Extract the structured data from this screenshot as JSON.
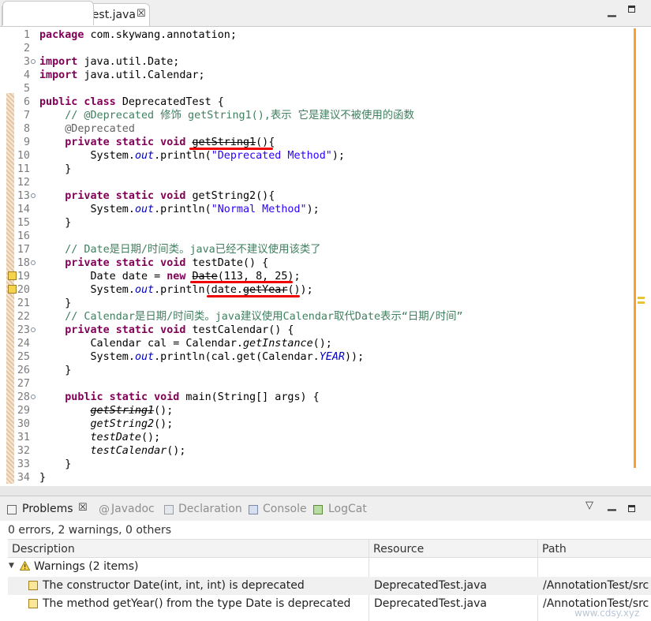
{
  "editor": {
    "tab_label": "DeprecatedTest.java",
    "tab_close": "☒",
    "minimize": "▁",
    "lines": [
      {
        "n": "1",
        "fold": false,
        "warn": false,
        "seg": [
          [
            "kw",
            "package"
          ],
          [
            "",
            "com.skywang.annotation;"
          ]
        ]
      },
      {
        "n": "2",
        "fold": false,
        "warn": false,
        "seg": []
      },
      {
        "n": "3",
        "fold": true,
        "warn": false,
        "seg": [
          [
            "kw",
            "import"
          ],
          [
            "",
            "java.util.Date;"
          ]
        ]
      },
      {
        "n": "4",
        "fold": false,
        "warn": false,
        "seg": [
          [
            "kw",
            "import"
          ],
          [
            "",
            "java.util.Calendar;"
          ]
        ]
      },
      {
        "n": "5",
        "fold": false,
        "warn": false,
        "seg": []
      },
      {
        "n": "6",
        "fold": false,
        "warn": false,
        "seg": [
          [
            "kw",
            "public class"
          ],
          [
            "",
            "DeprecatedTest {"
          ]
        ]
      },
      {
        "n": "7",
        "fold": false,
        "warn": false,
        "seg": [
          [
            "",
            "    "
          ],
          [
            "cm",
            "// @Deprecated 修饰 getString1(),表示 它是建议不被使用的函数"
          ]
        ]
      },
      {
        "n": "8",
        "fold": false,
        "warn": false,
        "seg": [
          [
            "",
            "    "
          ],
          [
            "ann",
            "@Deprecated"
          ]
        ]
      },
      {
        "n": "9",
        "fold": false,
        "warn": false,
        "seg": [
          [
            "",
            "    "
          ],
          [
            "kw",
            "private static void"
          ],
          [
            "",
            " "
          ],
          [
            "dep",
            "getString1"
          ],
          [
            "",
            "(){"
          ]
        ]
      },
      {
        "n": "10",
        "fold": false,
        "warn": false,
        "seg": [
          [
            "",
            "        System."
          ],
          [
            "fld",
            "out"
          ],
          [
            "",
            ".println("
          ],
          [
            "str",
            "\"Deprecated Method\""
          ],
          [
            "",
            ");"
          ]
        ]
      },
      {
        "n": "11",
        "fold": false,
        "warn": false,
        "seg": [
          [
            "",
            "    }"
          ]
        ]
      },
      {
        "n": "12",
        "fold": false,
        "warn": false,
        "seg": []
      },
      {
        "n": "13",
        "fold": true,
        "warn": false,
        "seg": [
          [
            "",
            "    "
          ],
          [
            "kw",
            "private static void"
          ],
          [
            "",
            " getString2(){"
          ]
        ]
      },
      {
        "n": "14",
        "fold": false,
        "warn": false,
        "seg": [
          [
            "",
            "        System."
          ],
          [
            "fld",
            "out"
          ],
          [
            "",
            ".println("
          ],
          [
            "str",
            "\"Normal Method\""
          ],
          [
            "",
            ");"
          ]
        ]
      },
      {
        "n": "15",
        "fold": false,
        "warn": false,
        "seg": [
          [
            "",
            "    }"
          ]
        ]
      },
      {
        "n": "16",
        "fold": false,
        "warn": false,
        "seg": []
      },
      {
        "n": "17",
        "fold": false,
        "warn": false,
        "seg": [
          [
            "",
            "    "
          ],
          [
            "cm",
            "// Date是日期/时间类。java已经不建议使用该类了"
          ]
        ]
      },
      {
        "n": "18",
        "fold": true,
        "warn": false,
        "seg": [
          [
            "",
            "    "
          ],
          [
            "kw",
            "private static void"
          ],
          [
            "",
            " testDate() {"
          ]
        ]
      },
      {
        "n": "19",
        "fold": false,
        "warn": true,
        "seg": [
          [
            "",
            "        Date date = "
          ],
          [
            "kw",
            "new"
          ],
          [
            "",
            " "
          ],
          [
            "dep",
            "Date"
          ],
          [
            "",
            "(113, 8, 25);"
          ]
        ]
      },
      {
        "n": "20",
        "fold": false,
        "warn": true,
        "seg": [
          [
            "",
            "        System."
          ],
          [
            "fld",
            "out"
          ],
          [
            "",
            ".println(date."
          ],
          [
            "dep",
            "getYear"
          ],
          [
            "",
            "());"
          ]
        ]
      },
      {
        "n": "21",
        "fold": false,
        "warn": false,
        "seg": [
          [
            "",
            "    }"
          ]
        ]
      },
      {
        "n": "22",
        "fold": false,
        "warn": false,
        "seg": [
          [
            "",
            "    "
          ],
          [
            "cm",
            "// Calendar是日期/时间类。java建议使用Calendar取代Date表示“日期/时间”"
          ]
        ]
      },
      {
        "n": "23",
        "fold": true,
        "warn": false,
        "seg": [
          [
            "",
            "    "
          ],
          [
            "kw",
            "private static void"
          ],
          [
            "",
            " testCalendar() {"
          ]
        ]
      },
      {
        "n": "24",
        "fold": false,
        "warn": false,
        "seg": [
          [
            "",
            "        Calendar cal = Calendar."
          ],
          [
            "it",
            "getInstance"
          ],
          [
            "",
            "();"
          ]
        ]
      },
      {
        "n": "25",
        "fold": false,
        "warn": false,
        "seg": [
          [
            "",
            "        System."
          ],
          [
            "fld",
            "out"
          ],
          [
            "",
            ".println(cal.get(Calendar."
          ],
          [
            "fld",
            "YEAR"
          ],
          [
            "",
            "));"
          ]
        ]
      },
      {
        "n": "26",
        "fold": false,
        "warn": false,
        "seg": [
          [
            "",
            "    }"
          ]
        ]
      },
      {
        "n": "27",
        "fold": false,
        "warn": false,
        "seg": []
      },
      {
        "n": "28",
        "fold": true,
        "warn": false,
        "seg": [
          [
            "",
            "    "
          ],
          [
            "kw",
            "public static void"
          ],
          [
            "",
            " main(String[] args) {"
          ]
        ]
      },
      {
        "n": "29",
        "fold": false,
        "warn": false,
        "seg": [
          [
            "",
            "        "
          ],
          [
            "it dep",
            "getString1"
          ],
          [
            "",
            "();"
          ]
        ]
      },
      {
        "n": "30",
        "fold": false,
        "warn": false,
        "seg": [
          [
            "",
            "        "
          ],
          [
            "it",
            "getString2"
          ],
          [
            "",
            "();"
          ]
        ]
      },
      {
        "n": "31",
        "fold": false,
        "warn": false,
        "seg": [
          [
            "",
            "        "
          ],
          [
            "it",
            "testDate"
          ],
          [
            "",
            "();"
          ]
        ]
      },
      {
        "n": "32",
        "fold": false,
        "warn": false,
        "seg": [
          [
            "",
            "        "
          ],
          [
            "it",
            "testCalendar"
          ],
          [
            "",
            "();"
          ]
        ]
      },
      {
        "n": "33",
        "fold": false,
        "warn": false,
        "seg": [
          [
            "",
            "    }"
          ]
        ]
      },
      {
        "n": "34",
        "fold": false,
        "warn": false,
        "seg": [
          [
            "",
            "}"
          ]
        ]
      }
    ]
  },
  "views": {
    "problems": "Problems",
    "problems_close": "☒",
    "javadoc": "Javadoc",
    "declaration": "Declaration",
    "console": "Console",
    "logcat": "LogCat",
    "menu": "▽",
    "minimize": "▁"
  },
  "problems": {
    "summary": "0 errors, 2 warnings, 0 others",
    "columns": [
      "Description",
      "Resource",
      "Path"
    ],
    "group": {
      "expander": "▼",
      "label": "Warnings (2 items)"
    },
    "rows": [
      {
        "description": "The constructor Date(int, int, int) is deprecated",
        "resource": "DeprecatedTest.java",
        "path": "/AnnotationTest/src"
      },
      {
        "description": "The method getYear() from the type Date is deprecated",
        "resource": "DeprecatedTest.java",
        "path": "/AnnotationTest/src"
      }
    ]
  },
  "watermark": "www.cdsy.xyz",
  "colors": {
    "keyword": "#7f0055",
    "string": "#2a00ff",
    "comment": "#3f7f5f",
    "field": "#0000c0",
    "annotation_mark": "#e00000",
    "warning": "#f4d44d"
  }
}
